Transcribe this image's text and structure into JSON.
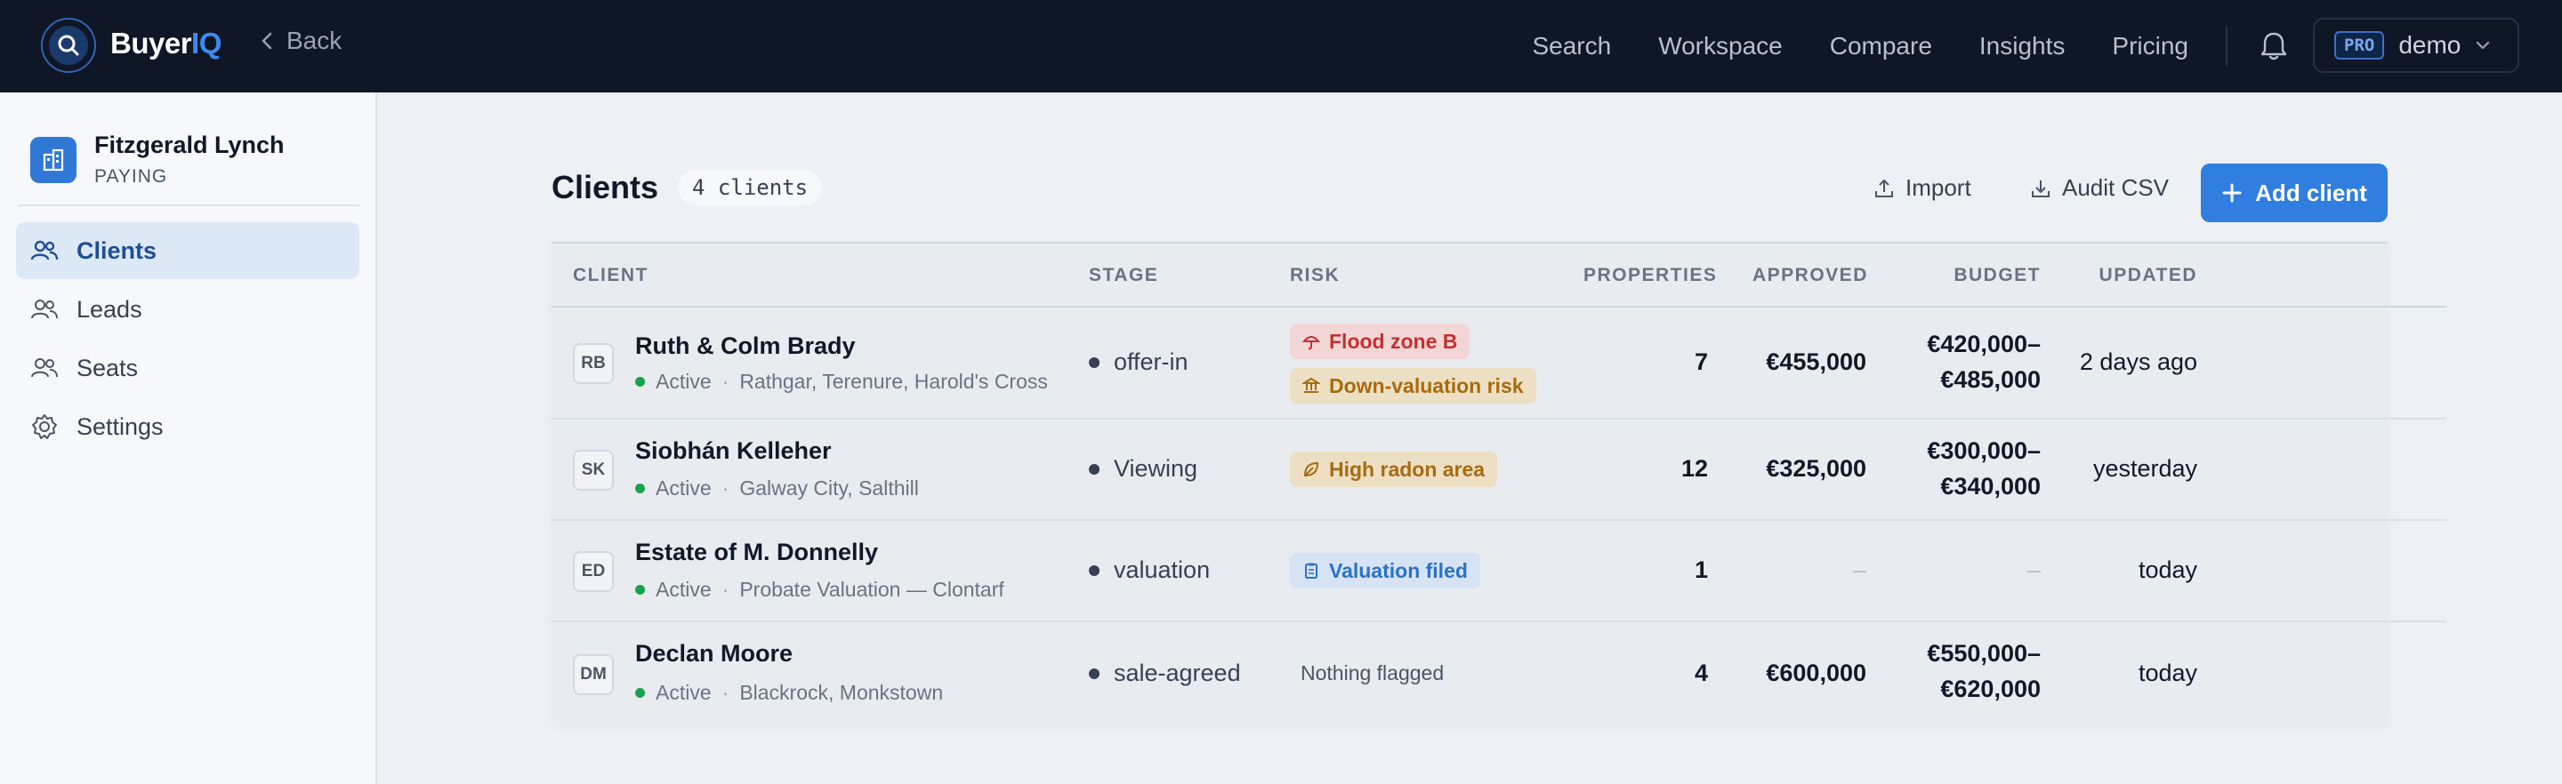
{
  "app": {
    "brand_main": "Buyer",
    "brand_accent": "IQ",
    "back_label": "Back"
  },
  "nav": {
    "links": [
      "Search",
      "Workspace",
      "Compare",
      "Insights",
      "Pricing"
    ],
    "plan_badge": "PRO",
    "account": "demo"
  },
  "sidebar": {
    "org_name": "Fitzgerald Lynch",
    "org_plan": "PAYING",
    "items": [
      {
        "label": "Clients",
        "icon": "users-icon",
        "active": true
      },
      {
        "label": "Leads",
        "icon": "users-icon",
        "active": false
      },
      {
        "label": "Seats",
        "icon": "users-icon",
        "active": false
      },
      {
        "label": "Settings",
        "icon": "gear-icon",
        "active": false
      }
    ]
  },
  "main": {
    "title": "Clients",
    "count": "4 clients",
    "import_label": "Import",
    "audit_label": "Audit CSV",
    "add_label": "Add client"
  },
  "table": {
    "headers": {
      "client": "CLIENT",
      "stage": "STAGE",
      "risk": "RISK",
      "properties": "PROPERTIES",
      "approved": "APPROVED",
      "budget": "BUDGET",
      "updated": "UPDATED"
    },
    "rows": [
      {
        "initials": "RB",
        "name": "Ruth & Colm Brady",
        "status": "Active",
        "area": "Rathgar, Terenure, Harold's Cross",
        "stage": "offer-in",
        "risks": [
          {
            "label": "Flood zone B",
            "tone": "red",
            "icon": "umbrella-icon"
          },
          {
            "label": "Down-valuation risk",
            "tone": "amber",
            "icon": "bank-icon"
          }
        ],
        "properties": "7",
        "approved": "€455,000",
        "budget_line1": "€420,000–",
        "budget_line2": "€485,000",
        "updated": "2 days ago"
      },
      {
        "initials": "SK",
        "name": "Siobhán Kelleher",
        "status": "Active",
        "area": "Galway City, Salthill",
        "stage": "Viewing",
        "risks": [
          {
            "label": "High radon area",
            "tone": "amber",
            "icon": "leaf-icon"
          }
        ],
        "properties": "12",
        "approved": "€325,000",
        "budget_line1": "€300,000–",
        "budget_line2": "€340,000",
        "updated": "yesterday"
      },
      {
        "initials": "ED",
        "name": "Estate of M. Donnelly",
        "status": "Active",
        "area": "Probate Valuation — Clontarf",
        "stage": "valuation",
        "risks": [
          {
            "label": "Valuation filed",
            "tone": "blue",
            "icon": "clipboard-icon"
          }
        ],
        "properties": "1",
        "approved": "–",
        "budget_line1": "–",
        "budget_line2": "",
        "updated": "today"
      },
      {
        "initials": "DM",
        "name": "Declan Moore",
        "status": "Active",
        "area": "Blackrock, Monkstown",
        "stage": "sale-agreed",
        "risks": [],
        "none_label": "Nothing flagged",
        "properties": "4",
        "approved": "€600,000",
        "budget_line1": "€550,000–",
        "budget_line2": "€620,000",
        "updated": "today"
      }
    ]
  },
  "colors": {
    "accent": "#2f7ee0",
    "topbar": "#0f1626",
    "risk_red": "#c53030",
    "risk_amber": "#a86b10",
    "risk_blue": "#2b72c7",
    "active_dot": "#16a34a"
  }
}
